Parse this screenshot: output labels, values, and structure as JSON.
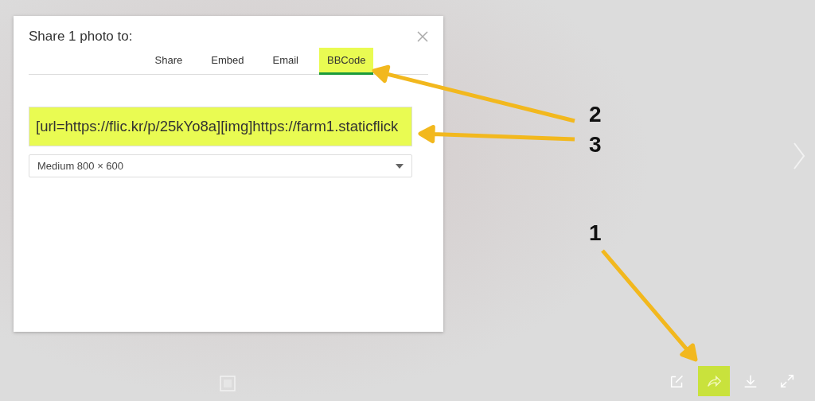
{
  "dialog": {
    "title": "Share 1 photo to:",
    "tabs": [
      {
        "label": "Share",
        "selected": false,
        "highlighted": false
      },
      {
        "label": "Embed",
        "selected": false,
        "highlighted": false
      },
      {
        "label": "Email",
        "selected": false,
        "highlighted": false
      },
      {
        "label": "BBCode",
        "selected": true,
        "highlighted": true
      }
    ],
    "code_field": {
      "value": "[url=https://flic.kr/p/25kYo8a][img]https://farm1.staticflick",
      "highlighted": true
    },
    "size_dropdown": {
      "value": "Medium 800 × 600"
    }
  },
  "toolbar": [
    {
      "kind": "edit",
      "highlighted": false
    },
    {
      "kind": "share",
      "highlighted": true
    },
    {
      "kind": "download",
      "highlighted": false
    },
    {
      "kind": "fullscreen",
      "highlighted": false
    }
  ],
  "annotations": [
    {
      "label": "2",
      "kind": "tab"
    },
    {
      "label": "3",
      "kind": "field"
    },
    {
      "label": "1",
      "kind": "toolbar"
    }
  ]
}
